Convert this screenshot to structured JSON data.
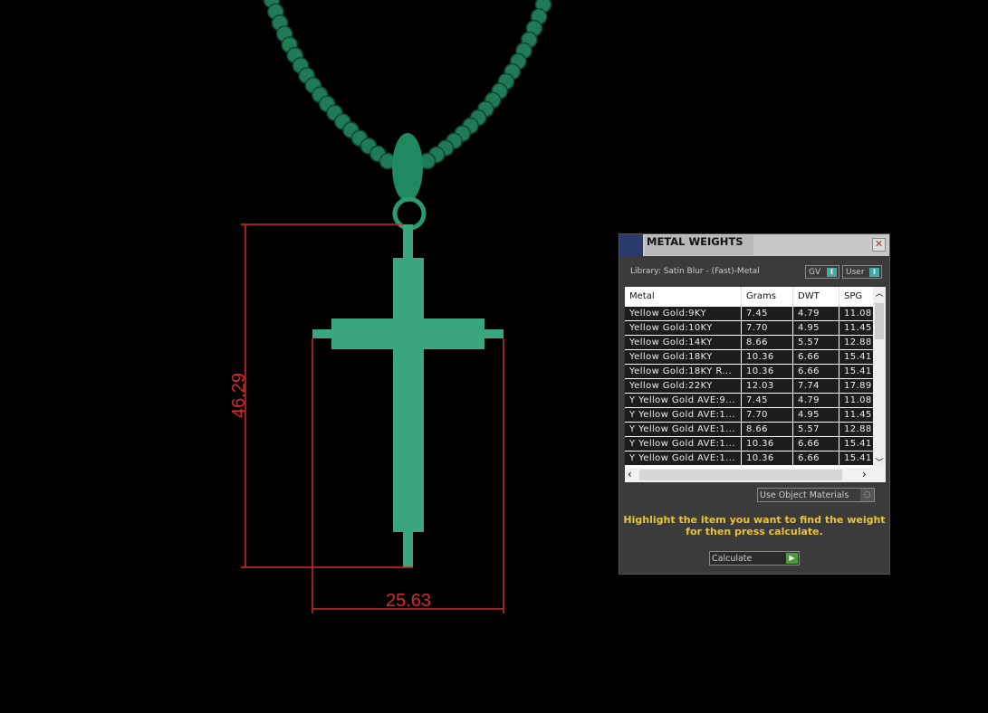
{
  "viewport": {
    "colors": {
      "model": "#3aa67e",
      "chain": "#1f7a55",
      "dimension": "#d8282c"
    },
    "dimensions": {
      "height_label": "46.29",
      "width_label": "25.63"
    }
  },
  "panel": {
    "title": "METAL WEIGHTS",
    "close_icon": "close-icon",
    "library_label": "Library: Satin Blur - (Fast)-Metal",
    "toggles": [
      {
        "label": "GV",
        "state": "I"
      },
      {
        "label": "User",
        "state": "I"
      }
    ],
    "columns": [
      "Metal",
      "Grams",
      "DWT",
      "SPG"
    ],
    "rows": [
      [
        "Yellow Gold:9KY",
        "7.45",
        "4.79",
        "11.08"
      ],
      [
        "Yellow Gold:10KY",
        "7.70",
        "4.95",
        "11.45"
      ],
      [
        "Yellow Gold:14KY",
        "8.66",
        "5.57",
        "12.88"
      ],
      [
        "Yellow Gold:18KY",
        "10.36",
        "6.66",
        "15.41"
      ],
      [
        "Yellow Gold:18KY R...",
        "10.36",
        "6.66",
        "15.41"
      ],
      [
        "Yellow Gold:22KY",
        "12.03",
        "7.74",
        "17.89"
      ],
      [
        "Y Yellow Gold AVE:9...",
        "7.45",
        "4.79",
        "11.08"
      ],
      [
        "Y Yellow Gold AVE:1...",
        "7.70",
        "4.95",
        "11.45"
      ],
      [
        "Y Yellow Gold AVE:1...",
        "8.66",
        "5.57",
        "12.88"
      ],
      [
        "Y Yellow Gold AVE:1...",
        "10.36",
        "6.66",
        "15.41"
      ],
      [
        "Y Yellow Gold AVE:1...",
        "10.36",
        "6.66",
        "15.41"
      ]
    ],
    "use_object_materials": "Use Object Materials",
    "hint_line1": "Highlight the item you want to find the weight",
    "hint_line2": "for then press calculate.",
    "calculate_label": "Calculate"
  }
}
